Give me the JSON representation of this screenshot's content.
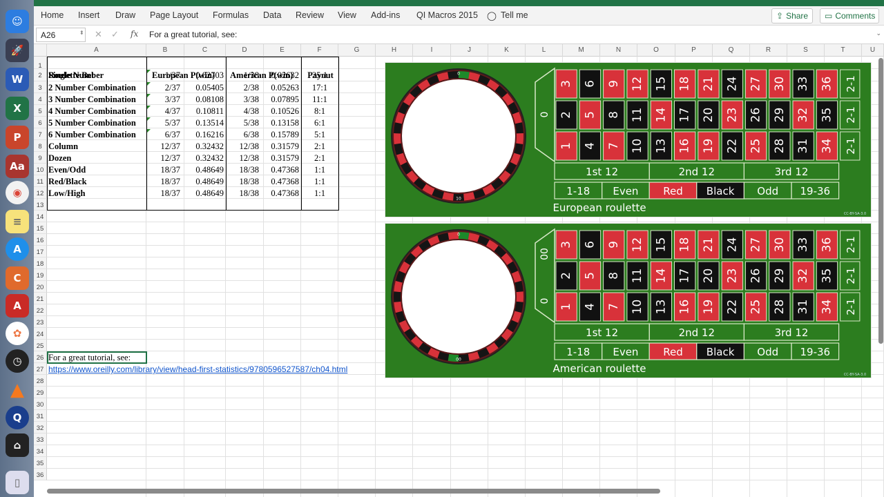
{
  "ribbon": {
    "tabs": [
      "Home",
      "Insert",
      "Draw",
      "Page Layout",
      "Formulas",
      "Data",
      "Review",
      "View",
      "Add-ins",
      "QI Macros 2015"
    ],
    "tell_me": "Tell me",
    "share": "Share",
    "comments": "Comments"
  },
  "formula_bar": {
    "name_box": "A26",
    "fx": "fx",
    "content": "For a great tutorial, see:"
  },
  "columns": [
    "A",
    "B",
    "C",
    "D",
    "E",
    "F",
    "G",
    "H",
    "I",
    "J",
    "K",
    "L",
    "M",
    "N",
    "O",
    "P",
    "Q",
    "R",
    "S",
    "T",
    "U"
  ],
  "rows": [
    "1",
    "2",
    "3",
    "4",
    "5",
    "6",
    "7",
    "8",
    "9",
    "10",
    "11",
    "12",
    "13",
    "14",
    "15",
    "16",
    "17",
    "18",
    "19",
    "20",
    "21",
    "22",
    "23",
    "24",
    "25",
    "26",
    "27",
    "28",
    "29",
    "30",
    "31",
    "32",
    "33",
    "34",
    "35",
    "36"
  ],
  "table": {
    "headers": [
      "Roulette Bet",
      "European P(win)",
      "American P(win)",
      "Payout"
    ],
    "rows": [
      [
        "Single Number",
        "1/37",
        "0.02703",
        "1/38",
        "0.02632",
        "35:1"
      ],
      [
        "2 Number Combination",
        "2/37",
        "0.05405",
        "2/38",
        "0.05263",
        "17:1"
      ],
      [
        "3 Number Combination",
        "3/37",
        "0.08108",
        "3/38",
        "0.07895",
        "11:1"
      ],
      [
        "4 Number Combination",
        "4/37",
        "0.10811",
        "4/38",
        "0.10526",
        "8:1"
      ],
      [
        "5 Number Combination",
        "5/37",
        "0.13514",
        "5/38",
        "0.13158",
        "6:1"
      ],
      [
        "6 Number Combination",
        "6/37",
        "0.16216",
        "6/38",
        "0.15789",
        "5:1"
      ],
      [
        "Column",
        "12/37",
        "0.32432",
        "12/38",
        "0.31579",
        "2:1"
      ],
      [
        "Dozen",
        "12/37",
        "0.32432",
        "12/38",
        "0.31579",
        "2:1"
      ],
      [
        "Even/Odd",
        "18/37",
        "0.48649",
        "18/38",
        "0.47368",
        "1:1"
      ],
      [
        "Red/Black",
        "18/37",
        "0.48649",
        "18/38",
        "0.47368",
        "1:1"
      ],
      [
        "Low/High",
        "18/37",
        "0.48649",
        "18/38",
        "0.47368",
        "1:1"
      ]
    ]
  },
  "a26": "For a great tutorial, see:",
  "a27_link": "https://www.oreilly.com/library/view/head-first-statistics/9780596527587/ch04.html",
  "boards": {
    "grid": [
      [
        "3",
        "6",
        "9",
        "12",
        "15",
        "18",
        "21",
        "24",
        "27",
        "30",
        "33",
        "36"
      ],
      [
        "2",
        "5",
        "8",
        "11",
        "14",
        "17",
        "20",
        "23",
        "26",
        "29",
        "32",
        "35"
      ],
      [
        "1",
        "4",
        "7",
        "10",
        "13",
        "16",
        "19",
        "22",
        "25",
        "28",
        "31",
        "34"
      ]
    ],
    "red": [
      "1",
      "3",
      "5",
      "7",
      "9",
      "12",
      "14",
      "16",
      "18",
      "19",
      "21",
      "23",
      "25",
      "27",
      "30",
      "32",
      "34",
      "36"
    ],
    "col_bet": "2-1",
    "dozens": [
      "1st 12",
      "2nd 12",
      "3rd 12"
    ],
    "outside": [
      "1-18",
      "Even",
      "Red",
      "Black",
      "Odd",
      "19-36"
    ],
    "european_title": "European roulette",
    "american_title": "American roulette",
    "european_zero": "0",
    "american_zeros": [
      "00",
      "0"
    ],
    "license": "CC-BY-SA-3.0",
    "wheel_eu": "0",
    "wheel_eu_top": "26",
    "wheel_eu_bottom": "10",
    "wheel_am_top": "0",
    "wheel_am_bottom": "00"
  },
  "colors": {
    "excel_green": "#217346",
    "felt": "#2c7d1f",
    "red": "#d8323a",
    "black": "#111111",
    "link": "#1155cc"
  }
}
